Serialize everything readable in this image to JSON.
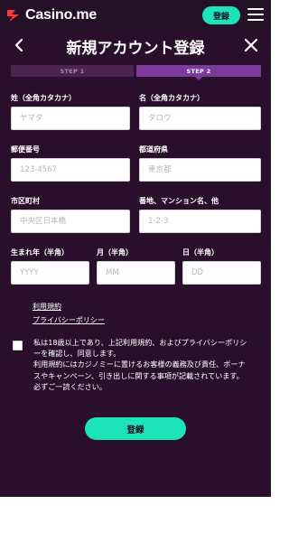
{
  "header": {
    "logo_text": "Casino.me",
    "login_label": "登録",
    "title": "新規アカウント登録"
  },
  "steps": [
    {
      "label": "STEP 1",
      "active": false
    },
    {
      "label": "STEP 2",
      "active": true
    }
  ],
  "form": {
    "last_name": {
      "label": "姓（全角カタカナ）",
      "placeholder": "ヤマダ"
    },
    "first_name": {
      "label": "名（全角カタカナ）",
      "placeholder": "タロウ"
    },
    "postal_code": {
      "label": "郵便番号",
      "placeholder": "123-4567"
    },
    "prefecture": {
      "label": "都道府県",
      "placeholder": "東京都"
    },
    "city": {
      "label": "市区町村",
      "placeholder": "中央区日本橋"
    },
    "address": {
      "label": "番地、マンション名、他",
      "placeholder": "1-2-3"
    },
    "birth_year": {
      "label": "生まれ年（半角）",
      "placeholder": "YYYY"
    },
    "birth_month": {
      "label": "月（半角）",
      "placeholder": "MM"
    },
    "birth_day": {
      "label": "日（半角）",
      "placeholder": "DD"
    }
  },
  "links": {
    "terms": "利用規約",
    "privacy": "プライバシーポリシー"
  },
  "consent": {
    "checked": false,
    "text": "私は18歳以上であり、上記利用規約、およびプライバシーポリシーを確認し、同意します。\n利用規約にはカジノミーに置けるお客様の義務及び責任、ボーナスやキャンペーン、引き出しに関する事項が記載されています。必ずご一読ください。"
  },
  "submit_label": "登録",
  "colors": {
    "background": "#2a0f2d",
    "accent": "#1de3b8",
    "step_active": "#7b3b9a",
    "step_inactive": "#4b2450",
    "logo_red": "#ff3b30"
  },
  "icons": {
    "logo": "casino-me-logo-icon",
    "menu": "hamburger-menu-icon",
    "back": "chevron-left-icon",
    "close": "close-icon"
  }
}
